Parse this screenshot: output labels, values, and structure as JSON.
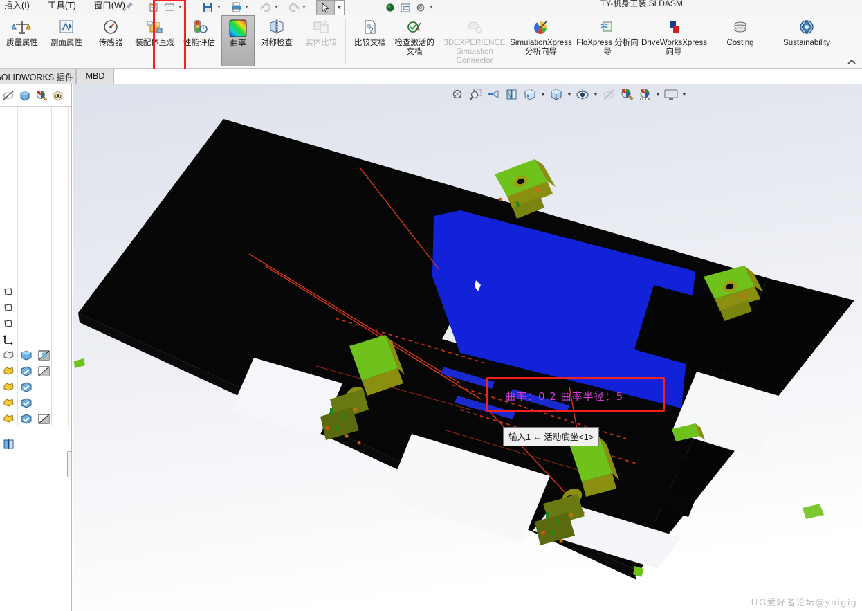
{
  "window": {
    "title": "TY-机身工装.SLDASM"
  },
  "menu": {
    "items": [
      {
        "label": "插入(I)",
        "name": "menu-insert"
      },
      {
        "label": "工具(T)",
        "name": "menu-tools"
      },
      {
        "label": "窗口(W)",
        "name": "menu-window"
      }
    ],
    "pin_icon": "pushpin-icon"
  },
  "quick_access": {
    "buttons": [
      {
        "name": "new-document-button",
        "icon": "new-doc-icon"
      },
      {
        "name": "open-document-button",
        "icon": "open-folder-icon"
      },
      {
        "name": "save-button",
        "icon": "save-disk-icon"
      },
      {
        "name": "print-button",
        "icon": "printer-icon"
      },
      {
        "name": "undo-button",
        "icon": "undo-arrow-icon"
      },
      {
        "name": "redo-button",
        "icon": "redo-arrow-icon"
      },
      {
        "name": "select-button",
        "icon": "cursor-arrow-icon"
      },
      {
        "name": "rebuild-button",
        "icon": "rebuild-icon"
      },
      {
        "name": "options-list-button",
        "icon": "list-icon"
      },
      {
        "name": "settings-button",
        "icon": "gear-icon"
      }
    ]
  },
  "ribbon": {
    "buttons": [
      {
        "label": "质量属性",
        "name": "mass-properties-button",
        "icon": "scale-icon",
        "disabled": false,
        "wide": false,
        "selected": false
      },
      {
        "label": "剖面属性",
        "name": "section-properties-button",
        "icon": "section-icon",
        "disabled": false,
        "wide": false,
        "selected": false
      },
      {
        "label": "传感器",
        "name": "sensor-button",
        "icon": "gauge-icon",
        "disabled": false,
        "wide": false,
        "selected": false
      },
      {
        "label": "装配体直观",
        "name": "assembly-visualization-button",
        "icon": "assembly-vis-icon",
        "disabled": false,
        "wide": false,
        "selected": false
      },
      {
        "label": "性能评估",
        "name": "performance-evaluation-button",
        "icon": "traffic-light-icon",
        "disabled": false,
        "wide": false,
        "selected": false
      },
      {
        "label": "曲率",
        "name": "curvature-button",
        "icon": "curvature-gradient-icon",
        "disabled": false,
        "wide": false,
        "selected": true
      },
      {
        "label": "对称检查",
        "name": "symmetry-check-button",
        "icon": "symmetry-icon",
        "disabled": false,
        "wide": false,
        "selected": false
      },
      {
        "label": "实体比较",
        "name": "geometry-compare-button",
        "icon": "geometry-compare-icon",
        "disabled": true,
        "wide": false,
        "selected": false
      },
      {
        "label": "比较文档",
        "name": "compare-documents-button",
        "icon": "compare-doc-icon",
        "disabled": false,
        "wide": false,
        "selected": false
      },
      {
        "label": "检查激活的文档",
        "name": "check-active-document-button",
        "icon": "check-doc-icon",
        "disabled": false,
        "wide": false,
        "selected": false
      },
      {
        "label": "3DEXPERIENCE Simulation Connector",
        "name": "3dexperience-simulation-connector-button",
        "icon": "3dx-sim-icon",
        "disabled": true,
        "wide": true,
        "selected": false
      },
      {
        "label": "SimulationXpress 分析向导",
        "name": "simulationxpress-button",
        "icon": "simulationxpress-icon",
        "disabled": false,
        "wide": true,
        "selected": false
      },
      {
        "label": "FloXpress 分析向导",
        "name": "floxpress-button",
        "icon": "floxpress-icon",
        "disabled": false,
        "wide": true,
        "selected": false
      },
      {
        "label": "DriveWorksXpress 向导",
        "name": "driveworksxpress-button",
        "icon": "driveworksxpress-icon",
        "disabled": false,
        "wide": true,
        "selected": false
      },
      {
        "label": "Costing",
        "name": "costing-button",
        "icon": "costing-coins-icon",
        "disabled": false,
        "wide": true,
        "selected": false
      },
      {
        "label": "Sustainability",
        "name": "sustainability-button",
        "icon": "sustainability-icon",
        "disabled": false,
        "wide": true,
        "selected": false
      }
    ],
    "collapse_icon": "chevron-up-icon",
    "overflow_icon": "chevron-down-icon",
    "highlight_color": "#f4221e"
  },
  "tabs": [
    {
      "label": "SOLIDWORKS 插件",
      "name": "tab-solidworks-addins",
      "active": false
    },
    {
      "label": "MBD",
      "name": "tab-mbd",
      "active": false
    }
  ],
  "left_panel": {
    "toolbar_icons": [
      {
        "name": "hide-show-icon",
        "glyph": "hide-show"
      },
      {
        "name": "display-state-icon",
        "glyph": "cube"
      },
      {
        "name": "appearance-icon",
        "glyph": "palette-pencil"
      },
      {
        "name": "view-icon",
        "glyph": "eye-box"
      }
    ],
    "tree_rows": [
      {
        "name": "tree-row-plane-front",
        "icons": [
          "plane-icon"
        ]
      },
      {
        "name": "tree-row-plane-top",
        "icons": [
          "plane-icon"
        ]
      },
      {
        "name": "tree-row-plane-right",
        "icons": [
          "plane-icon"
        ]
      },
      {
        "name": "tree-row-origin",
        "icons": [
          "origin-icon"
        ]
      },
      {
        "name": "tree-row-component-1",
        "icons": [
          "component-gray-icon",
          "cube-blue-icon",
          "appearance-half-icon"
        ]
      },
      {
        "name": "tree-row-component-2",
        "icons": [
          "component-yellow-icon",
          "cube-check-icon",
          "appearance-tri-icon"
        ]
      },
      {
        "name": "tree-row-component-3",
        "icons": [
          "component-yellow-icon",
          "cube-check-icon"
        ]
      },
      {
        "name": "tree-row-component-4",
        "icons": [
          "component-yellow-icon",
          "cube-check-icon"
        ]
      },
      {
        "name": "tree-row-component-5",
        "icons": [
          "component-yellow-icon",
          "cube-check-icon",
          "appearance-tri-icon"
        ]
      },
      {
        "name": "tree-row-mate-group",
        "icons": [
          "mate-icon"
        ]
      }
    ],
    "splitter_icon": "splitter-handle-icon"
  },
  "heads_up_view": {
    "buttons": [
      {
        "name": "zoom-to-fit-button",
        "icon": "zoom-fit-icon",
        "caret": false
      },
      {
        "name": "zoom-to-area-button",
        "icon": "zoom-area-icon",
        "caret": false
      },
      {
        "name": "previous-view-button",
        "icon": "previous-view-icon",
        "caret": false
      },
      {
        "name": "section-view-button",
        "icon": "section-view-icon",
        "caret": false
      },
      {
        "name": "view-orientation-button",
        "icon": "view-orientation-icon",
        "caret": true
      },
      {
        "name": "display-style-button",
        "icon": "display-style-icon",
        "caret": true
      },
      {
        "name": "hide-show-items-button",
        "icon": "hide-show-items-icon",
        "caret": true
      },
      {
        "name": "edit-appearance-button",
        "icon": "edit-appearance-icon",
        "caret": false
      },
      {
        "name": "apply-scene-button",
        "icon": "apply-scene-icon",
        "caret": false
      },
      {
        "name": "view-settings-button",
        "icon": "view-settings-icon",
        "caret": true
      },
      {
        "name": "display-pane-button",
        "icon": "monitor-icon",
        "caret": true
      }
    ]
  },
  "viewport": {
    "callout": {
      "text": "曲率：0.2   曲率半径：5",
      "border_color": "#f4221e",
      "text_color": "#cf3fd4"
    },
    "tooltip": {
      "text": "输入1 ← 活动底坐<1>"
    },
    "model_colors": {
      "body_black": "#050505",
      "selected_face_blue": "#1222d8",
      "green_component": "#6fc21c",
      "olive_shade": "#8a8f12",
      "edge_red": "#c6371b",
      "sketch_red": "#e33b1b"
    },
    "background_top": "#dde1eb",
    "background_bottom": "#ffffff"
  },
  "watermark": {
    "text": "UG爱好者论坛@ynigig"
  }
}
